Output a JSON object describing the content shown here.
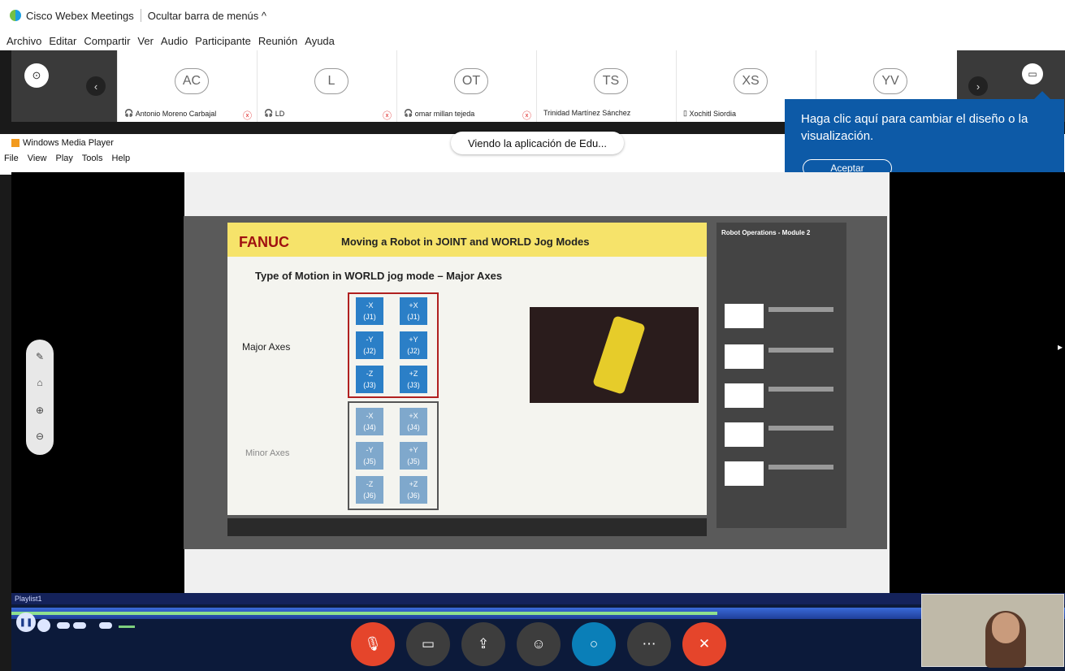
{
  "app": {
    "title": "Cisco Webex Meetings",
    "hide_menu": "Ocultar barra de menús ^"
  },
  "menubar": [
    "Archivo",
    "Editar",
    "Compartir",
    "Ver",
    "Audio",
    "Participante",
    "Reunión",
    "Ayuda"
  ],
  "participants": [
    {
      "initials": "AC",
      "name": "Antonio Moreno Carbajal",
      "muted": true
    },
    {
      "initials": "L",
      "name": "LD",
      "muted": true
    },
    {
      "initials": "OT",
      "name": "omar millan tejeda",
      "muted": true
    },
    {
      "initials": "TS",
      "name": "Trinidad Martínez Sánchez",
      "muted": false
    },
    {
      "initials": "XS",
      "name": "Xochitl Siordia",
      "muted": false
    },
    {
      "initials": "YV",
      "name": "",
      "muted": false
    }
  ],
  "tooltip": {
    "text": "Haga clic aquí para cambiar el diseño o la visualización.",
    "accept": "Aceptar"
  },
  "wmp": {
    "title": "Windows Media Player",
    "menu": [
      "File",
      "View",
      "Play",
      "Tools",
      "Help"
    ],
    "playlist": "Playlist1"
  },
  "viewing_label": "Viendo la aplicación de Edu...",
  "slide": {
    "brand": "FANUC",
    "title": "Moving a Robot in JOINT and WORLD Jog Modes",
    "subtitle": "Type of Motion in WORLD jog mode – Major Axes",
    "major_label": "Major Axes",
    "minor_label": "Minor Axes",
    "major_keys": [
      [
        "-X",
        "(J1)"
      ],
      [
        "+X",
        "(J1)"
      ],
      [
        "-Y",
        "(J2)"
      ],
      [
        "+Y",
        "(J2)"
      ],
      [
        "-Z",
        "(J3)"
      ],
      [
        "+Z",
        "(J3)"
      ]
    ],
    "minor_keys": [
      [
        "-X",
        "(J4)"
      ],
      [
        "+X",
        "(J4)"
      ],
      [
        "-Y",
        "(J5)"
      ],
      [
        "+Y",
        "(J5)"
      ],
      [
        "-Z",
        "(J6)"
      ],
      [
        "+Z",
        "(J6)"
      ]
    ],
    "side_title": "Robot Operations - Module 2"
  },
  "player": {
    "progress": 0.67
  },
  "colors": {
    "webex_blue": "#0d5aa7",
    "end_red": "#e5452b",
    "chat_blue": "#0a7fb8"
  }
}
